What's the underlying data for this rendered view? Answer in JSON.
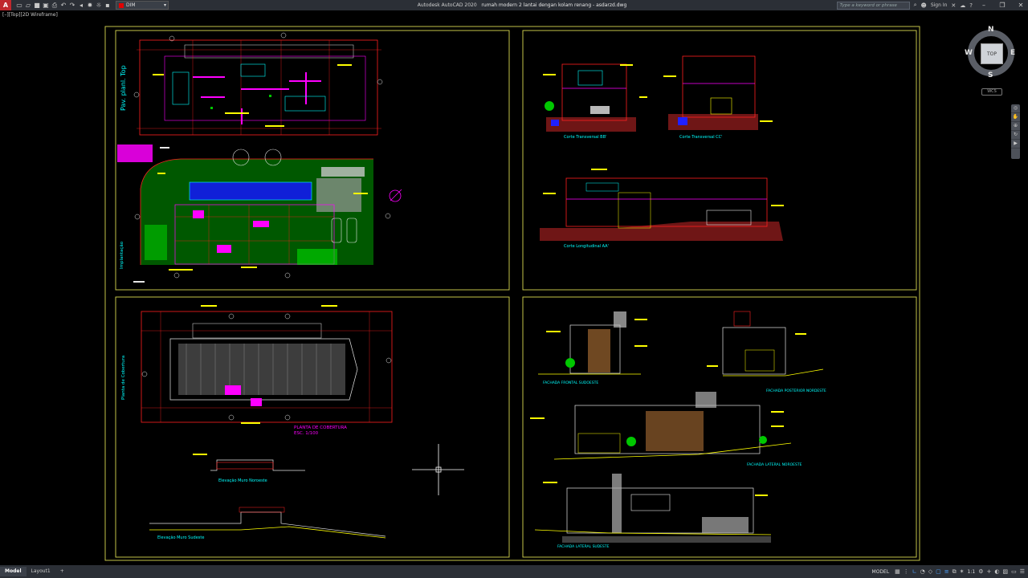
{
  "app": {
    "title": "Autodesk AutoCAD 2020",
    "file_title": "rumah modern 2 lantai dengan kolam renang - asdarzd.dwg"
  },
  "quick_access": {
    "layer_name": "DIM",
    "layer_color": "#e10000"
  },
  "search": {
    "placeholder": "Type a keyword or phrase"
  },
  "user": {
    "sign_in": "Sign In"
  },
  "viewport": {
    "label": "[–][Top][2D Wireframe]"
  },
  "viewcube": {
    "top": "TOP",
    "north": "N",
    "south": "S",
    "east": "E",
    "west": "W",
    "wcs": "WCS"
  },
  "sheets": {
    "plan_title": "Pav. planl. Top",
    "site_title": "Implantação",
    "roof_title": "Planta de Cobertura",
    "roof_label": "PLANTA DE COBERTURA",
    "roof_scale": "ESC. 1/100",
    "wall_north": "Elevação Muro Noroeste",
    "wall_south": "Elevação Muro Sudeste",
    "section_bb": "Corte Transversal BB'",
    "section_cc": "Corte Transversal CC'",
    "section_aa": "Corte Longitudinal AA'",
    "facade_front": "FACHADA FRONTAL SUDOESTE",
    "facade_rear": "FACHADA POSTERIOR NORDESTE",
    "facade_lat_ne": "FACHADA LATERAL NOROESTE",
    "facade_lat_sw": "FACHADA LATERAL SUDESTE"
  },
  "status": {
    "tab_model": "Model",
    "tab_layout": "Layout1",
    "model_button": "MODEL",
    "scale": "1:1"
  },
  "colors": {
    "frame": "#d8d850",
    "red": "#ff2020",
    "magenta": "#ff00ff",
    "yellow": "#ffff00",
    "cyan": "#00ffff",
    "green": "#00c800",
    "blue": "#2020ff",
    "white": "#e6e6e6"
  }
}
